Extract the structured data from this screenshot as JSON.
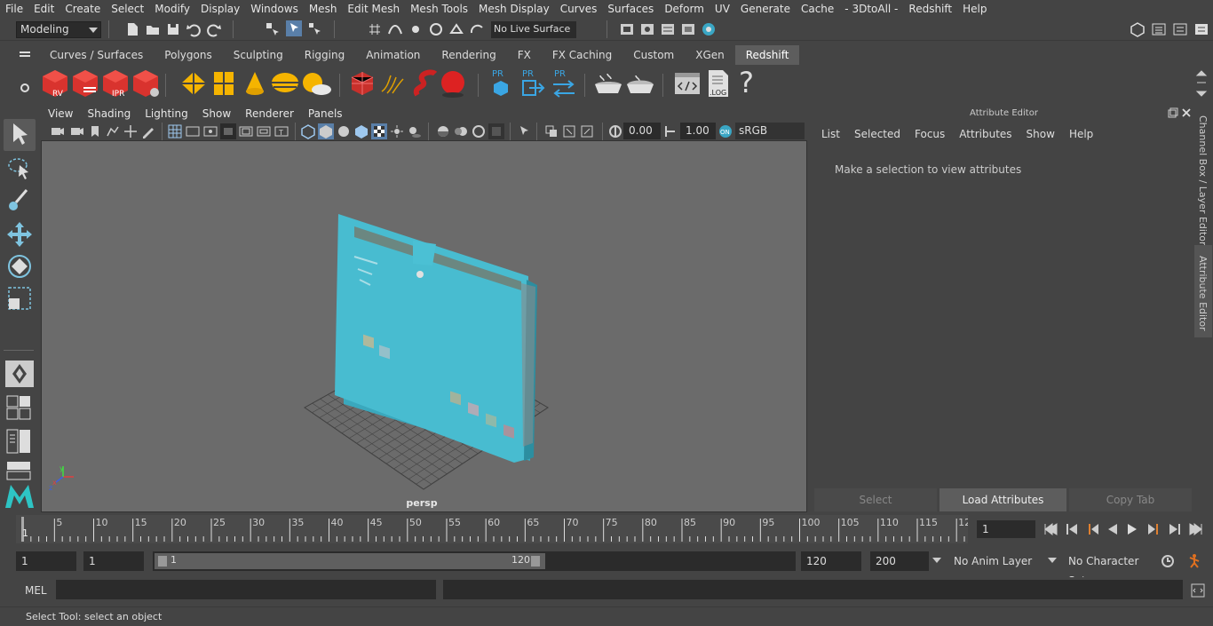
{
  "menubar": [
    "File",
    "Edit",
    "Create",
    "Select",
    "Modify",
    "Display",
    "Windows",
    "Mesh",
    "Edit Mesh",
    "Mesh Tools",
    "Mesh Display",
    "Curves",
    "Surfaces",
    "Deform",
    "UV",
    "Generate",
    "Cache",
    "- 3DtoAll -",
    "Redshift",
    "Help"
  ],
  "status": {
    "mode": "Modeling",
    "live_surface": "No Live Surface"
  },
  "shelf_tabs": [
    "Curves / Surfaces",
    "Polygons",
    "Sculpting",
    "Rigging",
    "Animation",
    "Rendering",
    "FX",
    "FX Caching",
    "Custom",
    "XGen",
    "Redshift"
  ],
  "shelf_active": "Redshift",
  "shelf_labels": {
    "rv": "RV",
    "ipr": "IPR",
    "pr1": "PR",
    "pr2": "PR",
    "pr3": "PR",
    "log": ".LOG",
    "help": "?"
  },
  "viewport": {
    "menu": [
      "View",
      "Shading",
      "Lighting",
      "Show",
      "Renderer",
      "Panels"
    ],
    "exposure": "0.00",
    "gamma": "1.00",
    "color_space": "sRGB gamma",
    "camera": "persp"
  },
  "attribute_editor": {
    "title": "Attribute Editor",
    "menu": [
      "List",
      "Selected",
      "Focus",
      "Attributes",
      "Show",
      "Help"
    ],
    "message": "Make a selection to view attributes",
    "buttons": {
      "select": "Select",
      "load": "Load Attributes",
      "copy": "Copy Tab"
    }
  },
  "side_tabs": {
    "channel_box": "Channel Box / Layer Editor",
    "attr_editor": "Attribute Editor"
  },
  "timeline": {
    "start_marker": "1",
    "ticks": [
      "5",
      "10",
      "15",
      "20",
      "25",
      "30",
      "35",
      "40",
      "45",
      "50",
      "55",
      "60",
      "65",
      "70",
      "75",
      "80",
      "85",
      "90",
      "95",
      "100",
      "105",
      "110",
      "115",
      "12"
    ],
    "current_frame": "1"
  },
  "range": {
    "start": "1",
    "playback_start": "1",
    "slider_start": "1",
    "slider_end": "120",
    "playback_end": "120",
    "end": "200",
    "anim_layer": "No Anim Layer",
    "char_set": "No Character Set"
  },
  "cmdline": {
    "label": "MEL"
  },
  "helpline": "Select Tool: select an object"
}
